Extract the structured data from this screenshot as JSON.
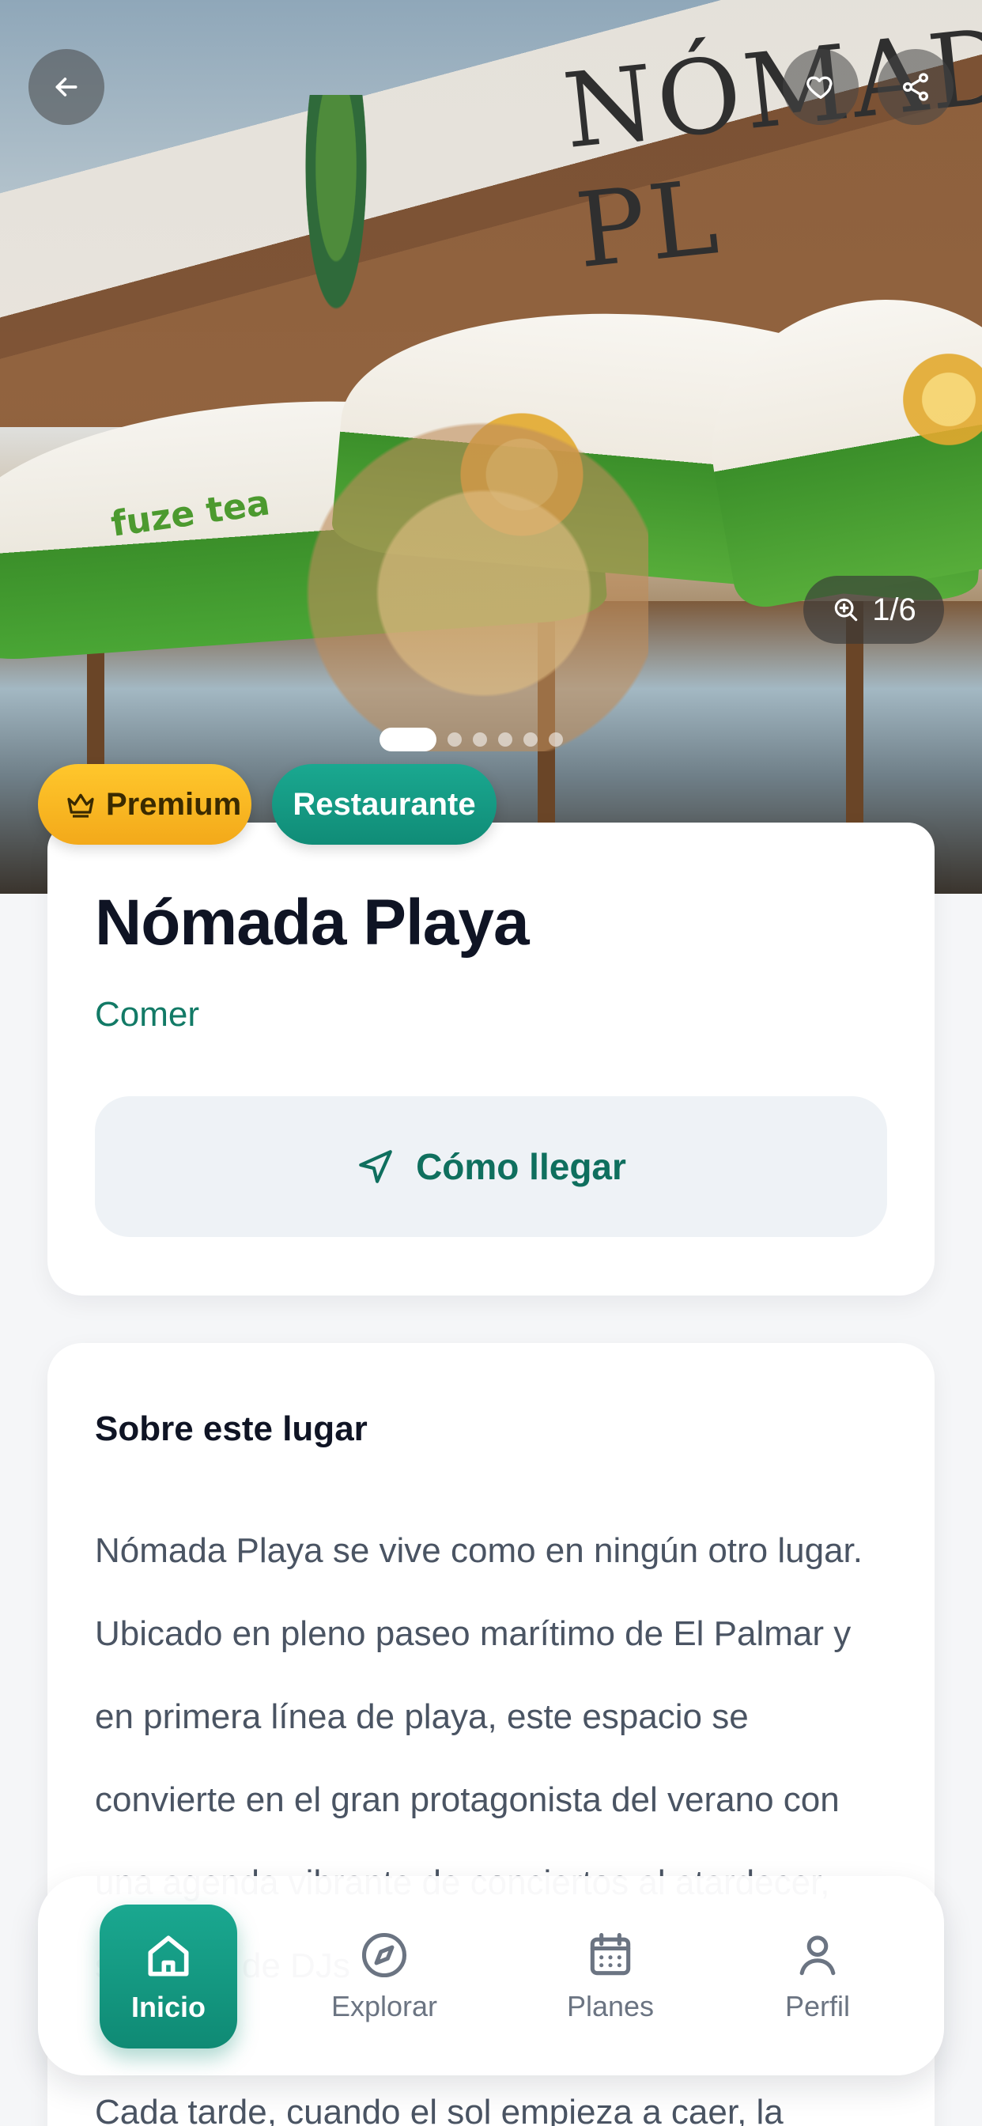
{
  "hero": {
    "sign_text": "NÓMADA PL",
    "umbrella_brand": "fuze tea",
    "image_counter": "1/6",
    "carousel": {
      "current": 1,
      "total": 6
    }
  },
  "header": {
    "back_icon": "arrow-left-icon",
    "favorite_icon": "heart-icon",
    "share_icon": "share-icon"
  },
  "badges": {
    "premium_label": "Premium",
    "category_label": "Restaurante"
  },
  "place": {
    "name": "Nómada Playa",
    "category": "Comer",
    "directions_label": "Cómo llegar"
  },
  "about": {
    "title": "Sobre este lugar",
    "paragraph_1": "Nómada Playa se vive como en ningún otro lugar. Ubicado en pleno paseo marítimo de El Palmar y en primera línea de playa, este espacio se convierte en el gran protagonista del verano con una agenda vibrante de conciertos al atardecer, sesiones de DJs",
    "paragraph_2": "Cada tarde, cuando el sol empieza a caer, la música"
  },
  "bottom_nav": {
    "items": [
      {
        "label": "Inicio",
        "icon": "home-icon",
        "active": true
      },
      {
        "label": "Explorar",
        "icon": "compass-icon",
        "active": false
      },
      {
        "label": "Planes",
        "icon": "calendar-icon",
        "active": false
      },
      {
        "label": "Perfil",
        "icon": "user-icon",
        "active": false
      }
    ]
  },
  "colors": {
    "brand_teal": "#108c77",
    "premium_yellow": "#f3a91a",
    "background": "#f5f6f8"
  }
}
